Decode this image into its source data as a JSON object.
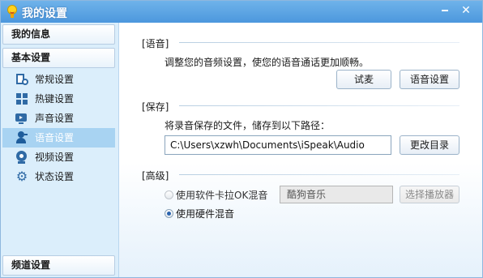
{
  "window": {
    "title": "我的设置"
  },
  "sidebar": {
    "my_info": "我的信息",
    "basic_settings": "基本设置",
    "items": [
      {
        "label": "常规设置",
        "icon": "general-settings-icon",
        "active": false
      },
      {
        "label": "热键设置",
        "icon": "hotkey-icon",
        "active": false
      },
      {
        "label": "声音设置",
        "icon": "sound-icon",
        "active": false
      },
      {
        "label": "语音设置",
        "icon": "voice-user-icon",
        "active": true
      },
      {
        "label": "视频设置",
        "icon": "webcam-icon",
        "active": false
      },
      {
        "label": "状态设置",
        "icon": "gear-icon",
        "active": false
      }
    ],
    "channel_settings": "频道设置"
  },
  "main": {
    "voice": {
      "section_title": "[语音]",
      "description": "调整您的音频设置，使您的语音通话更加顺畅。",
      "test_mic_button": "试麦",
      "voice_settings_button": "语音设置"
    },
    "save": {
      "section_title": "[保存]",
      "description": "将录音保存的文件，储存到以下路径：",
      "path_value": "C:\\Users\\xzwh\\Documents\\iSpeak\\Audio",
      "change_dir_button": "更改目录"
    },
    "advanced": {
      "section_title": "[高级]",
      "software_mix_label": "使用软件卡拉OK混音",
      "software_mix_checked": false,
      "software_mix_enabled": false,
      "player_value": "酷狗音乐",
      "select_player_button": "选择播放器",
      "hardware_mix_label": "使用硬件混音",
      "hardware_mix_checked": true
    }
  },
  "colors": {
    "titlebar": "#4c97dd",
    "sidebar_bg": "#dbeefb",
    "active_item": "#a8d3f2"
  }
}
